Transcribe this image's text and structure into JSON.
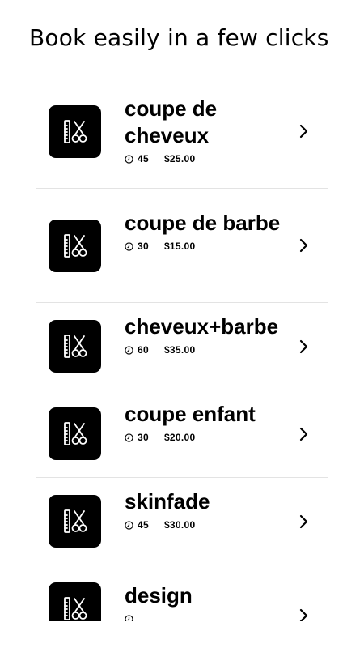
{
  "header": {
    "title": "Book easily in a few clicks"
  },
  "services": [
    {
      "name": "coupe de cheveux",
      "duration": "45",
      "price": "$25.00",
      "icon": "comb-scissors-icon"
    },
    {
      "name": "coupe de barbe",
      "duration": "30",
      "price": "$15.00",
      "icon": "comb-scissors-icon"
    },
    {
      "name": "cheveux+barbe",
      "duration": "60",
      "price": "$35.00",
      "icon": "comb-scissors-icon"
    },
    {
      "name": "coupe enfant",
      "duration": "30",
      "price": "$20.00",
      "icon": "comb-scissors-icon"
    },
    {
      "name": "skinfade",
      "duration": "45",
      "price": "$30.00",
      "icon": "comb-scissors-icon"
    },
    {
      "name": "design",
      "duration": "",
      "price": "",
      "icon": "comb-scissors-icon"
    }
  ],
  "colors": {
    "icon_background": "#000000",
    "divider": "#e3e3e3",
    "text": "#000000"
  }
}
